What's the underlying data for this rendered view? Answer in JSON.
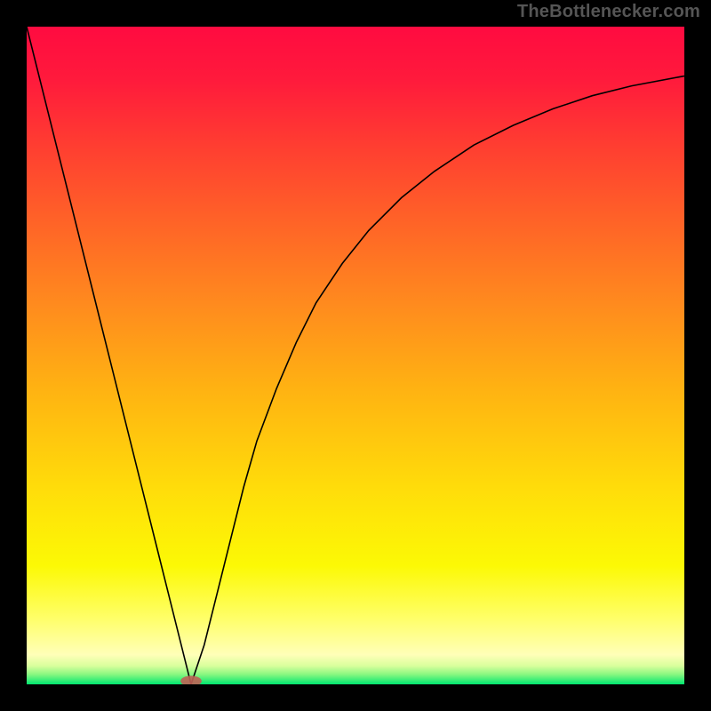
{
  "attribution": "TheBottlenecker.com",
  "chart_data": {
    "type": "line",
    "title": "",
    "xlabel": "",
    "ylabel": "",
    "xlim": [
      0,
      100
    ],
    "ylim": [
      0,
      100
    ],
    "background": {
      "type": "vertical-gradient",
      "stops": [
        {
          "offset": 0.0,
          "color": "#ff0b40"
        },
        {
          "offset": 0.08,
          "color": "#ff1a3c"
        },
        {
          "offset": 0.18,
          "color": "#ff3d31"
        },
        {
          "offset": 0.3,
          "color": "#ff6427"
        },
        {
          "offset": 0.42,
          "color": "#ff8a1e"
        },
        {
          "offset": 0.55,
          "color": "#ffb212"
        },
        {
          "offset": 0.7,
          "color": "#ffdc0a"
        },
        {
          "offset": 0.82,
          "color": "#fcf905"
        },
        {
          "offset": 0.9,
          "color": "#ffff69"
        },
        {
          "offset": 0.955,
          "color": "#ffffb8"
        },
        {
          "offset": 0.972,
          "color": "#d8ff9c"
        },
        {
          "offset": 0.985,
          "color": "#88f780"
        },
        {
          "offset": 1.0,
          "color": "#00e770"
        }
      ]
    },
    "series": [
      {
        "name": "bottleneck-curve",
        "color": "#000000",
        "width": 1.6,
        "points": [
          {
            "x": 0.0,
            "y": 100.0
          },
          {
            "x": 2.0,
            "y": 92.0
          },
          {
            "x": 4.0,
            "y": 84.0
          },
          {
            "x": 6.0,
            "y": 76.0
          },
          {
            "x": 8.0,
            "y": 68.0
          },
          {
            "x": 10.0,
            "y": 60.0
          },
          {
            "x": 12.0,
            "y": 52.0
          },
          {
            "x": 14.0,
            "y": 44.0
          },
          {
            "x": 16.0,
            "y": 36.0
          },
          {
            "x": 18.0,
            "y": 28.0
          },
          {
            "x": 20.0,
            "y": 20.0
          },
          {
            "x": 22.0,
            "y": 12.0
          },
          {
            "x": 24.0,
            "y": 4.0
          },
          {
            "x": 25.0,
            "y": 0.0
          },
          {
            "x": 27.0,
            "y": 6.0
          },
          {
            "x": 29.0,
            "y": 14.0
          },
          {
            "x": 31.0,
            "y": 22.0
          },
          {
            "x": 33.0,
            "y": 30.0
          },
          {
            "x": 35.0,
            "y": 37.0
          },
          {
            "x": 38.0,
            "y": 45.0
          },
          {
            "x": 41.0,
            "y": 52.0
          },
          {
            "x": 44.0,
            "y": 58.0
          },
          {
            "x": 48.0,
            "y": 64.0
          },
          {
            "x": 52.0,
            "y": 69.0
          },
          {
            "x": 57.0,
            "y": 74.0
          },
          {
            "x": 62.0,
            "y": 78.0
          },
          {
            "x": 68.0,
            "y": 82.0
          },
          {
            "x": 74.0,
            "y": 85.0
          },
          {
            "x": 80.0,
            "y": 87.5
          },
          {
            "x": 86.0,
            "y": 89.5
          },
          {
            "x": 92.0,
            "y": 91.0
          },
          {
            "x": 100.0,
            "y": 92.5
          }
        ]
      }
    ],
    "marker": {
      "name": "optimal-point",
      "x": 25.0,
      "y": 0.5,
      "rx": 1.6,
      "ry": 0.8,
      "color": "#c06055"
    }
  }
}
